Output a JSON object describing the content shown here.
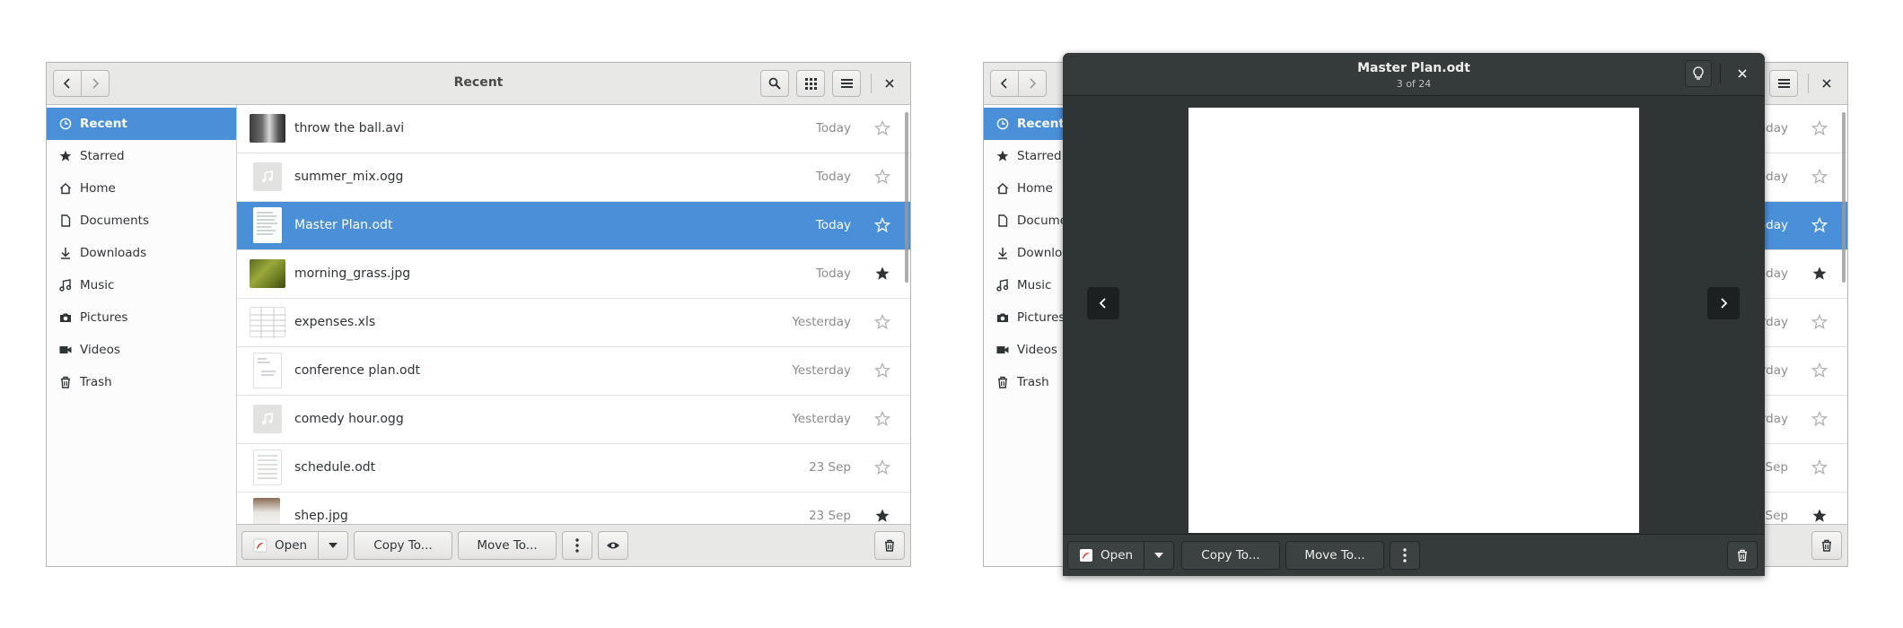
{
  "window1": {
    "title": "Recent",
    "sidebar": [
      {
        "label": "Recent",
        "icon": "clock-icon",
        "active": true
      },
      {
        "label": "Starred",
        "icon": "star-icon"
      },
      {
        "label": "Home",
        "icon": "home-icon"
      },
      {
        "label": "Documents",
        "icon": "document-icon"
      },
      {
        "label": "Downloads",
        "icon": "download-icon"
      },
      {
        "label": "Music",
        "icon": "music-icon"
      },
      {
        "label": "Pictures",
        "icon": "camera-icon"
      },
      {
        "label": "Videos",
        "icon": "video-icon"
      },
      {
        "label": "Trash",
        "icon": "trash-icon"
      }
    ],
    "files": [
      {
        "name": "throw the ball.avi",
        "date": "Today",
        "starred": false,
        "thumb": "dog-video"
      },
      {
        "name": "summer_mix.ogg",
        "date": "Today",
        "starred": false,
        "thumb": "audio"
      },
      {
        "name": "Master Plan.odt",
        "date": "Today",
        "starred": false,
        "thumb": "document",
        "selected": true
      },
      {
        "name": "morning_grass.jpg",
        "date": "Today",
        "starred": true,
        "thumb": "grass-photo"
      },
      {
        "name": "expenses.xls",
        "date": "Yesterday",
        "starred": false,
        "thumb": "spreadsheet"
      },
      {
        "name": "conference plan.odt",
        "date": "Yesterday",
        "starred": false,
        "thumb": "document"
      },
      {
        "name": "comedy hour.ogg",
        "date": "Yesterday",
        "starred": false,
        "thumb": "audio"
      },
      {
        "name": "schedule.odt",
        "date": "23 Sep",
        "starred": false,
        "thumb": "document"
      },
      {
        "name": "shep.jpg",
        "date": "23 Sep",
        "starred": true,
        "thumb": "dog-photo"
      }
    ],
    "actions": {
      "open": "Open",
      "copy": "Copy To...",
      "move": "Move To..."
    }
  },
  "window2": {
    "sidebar": [
      {
        "label": "Recent",
        "active": true
      },
      {
        "label": "Starred"
      },
      {
        "label": "Home"
      },
      {
        "label": "Documen"
      },
      {
        "label": "Downloa"
      },
      {
        "label": "Music"
      },
      {
        "label": "Pictures"
      },
      {
        "label": "Videos"
      },
      {
        "label": "Trash"
      }
    ],
    "dates": [
      "oday",
      "oday",
      "oday",
      "oday",
      "rday",
      "rday",
      "rday",
      "Sep",
      "Sep"
    ]
  },
  "preview": {
    "title": "Master Plan.odt",
    "counter": "3 of 24",
    "actions": {
      "open": "Open",
      "copy": "Copy To...",
      "move": "Move To..."
    }
  },
  "colors": {
    "accent": "#4a90d9",
    "preview_bg": "#2f3435"
  }
}
